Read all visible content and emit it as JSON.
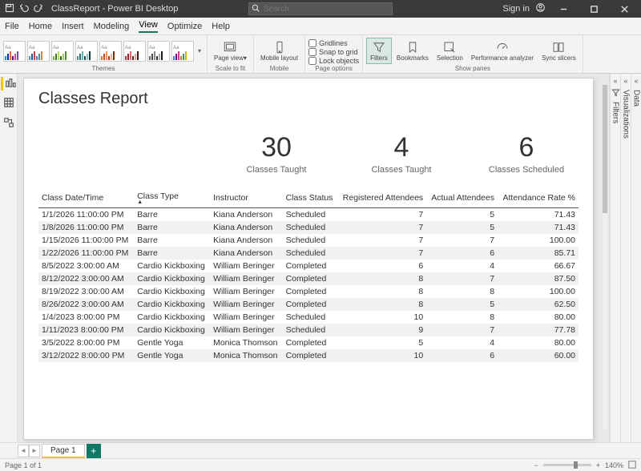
{
  "titlebar": {
    "title": "ClassReport - Power BI Desktop",
    "search_placeholder": "Search",
    "signin": "Sign in"
  },
  "menubar": {
    "file": "File",
    "home": "Home",
    "insert": "Insert",
    "modeling": "Modeling",
    "view": "View",
    "optimize": "Optimize",
    "help": "Help"
  },
  "ribbon": {
    "themes_label": "Themes",
    "pageview": "Page view",
    "scaletofit": "Scale to fit",
    "mobilelayout": "Mobile layout",
    "mobile": "Mobile",
    "gridlines": "Gridlines",
    "snap": "Snap to grid",
    "lock": "Lock objects",
    "pageoptions": "Page options",
    "filters": "Filters",
    "bookmarks": "Bookmarks",
    "selection": "Selection",
    "perf": "Performance analyzer",
    "sync": "Sync slicers",
    "showpanes": "Show panes"
  },
  "report": {
    "title": "Classes Report",
    "kpis": [
      {
        "num": "30",
        "lbl": "Classes Taught"
      },
      {
        "num": "4",
        "lbl": "Classes Taught"
      },
      {
        "num": "6",
        "lbl": "Classes Scheduled"
      }
    ],
    "columns": [
      "Class Date/Time",
      "Class Type",
      "Instructor",
      "Class Status",
      "Registered Attendees",
      "Actual Attendees",
      "Attendance Rate %"
    ],
    "rows": [
      [
        "1/1/2026 11:00:00 PM",
        "Barre",
        "Kiana Anderson",
        "Scheduled",
        "7",
        "5",
        "71.43"
      ],
      [
        "1/8/2026 11:00:00 PM",
        "Barre",
        "Kiana Anderson",
        "Scheduled",
        "7",
        "5",
        "71.43"
      ],
      [
        "1/15/2026 11:00:00 PM",
        "Barre",
        "Kiana Anderson",
        "Scheduled",
        "7",
        "7",
        "100.00"
      ],
      [
        "1/22/2026 11:00:00 PM",
        "Barre",
        "Kiana Anderson",
        "Scheduled",
        "7",
        "6",
        "85.71"
      ],
      [
        "8/5/2022 3:00:00 AM",
        "Cardio Kickboxing",
        "William Beringer",
        "Completed",
        "6",
        "4",
        "66.67"
      ],
      [
        "8/12/2022 3:00:00 AM",
        "Cardio Kickboxing",
        "William Beringer",
        "Completed",
        "8",
        "7",
        "87.50"
      ],
      [
        "8/19/2022 3:00:00 AM",
        "Cardio Kickboxing",
        "William Beringer",
        "Completed",
        "8",
        "8",
        "100.00"
      ],
      [
        "8/26/2022 3:00:00 AM",
        "Cardio Kickboxing",
        "William Beringer",
        "Completed",
        "8",
        "5",
        "62.50"
      ],
      [
        "1/4/2023 8:00:00 PM",
        "Cardio Kickboxing",
        "William Beringer",
        "Scheduled",
        "10",
        "8",
        "80.00"
      ],
      [
        "1/11/2023 8:00:00 PM",
        "Cardio Kickboxing",
        "William Beringer",
        "Scheduled",
        "9",
        "7",
        "77.78"
      ],
      [
        "3/5/2022 8:00:00 PM",
        "Gentle Yoga",
        "Monica Thomson",
        "Completed",
        "5",
        "4",
        "80.00"
      ],
      [
        "3/12/2022 8:00:00 PM",
        "Gentle Yoga",
        "Monica Thomson",
        "Completed",
        "10",
        "6",
        "60.00"
      ]
    ]
  },
  "rightpanes": {
    "filters": "Filters",
    "viz": "Visualizations",
    "data": "Data"
  },
  "pagestrip": {
    "page1": "Page 1"
  },
  "status": {
    "pageinfo": "Page 1 of 1",
    "zoom": "140%"
  }
}
